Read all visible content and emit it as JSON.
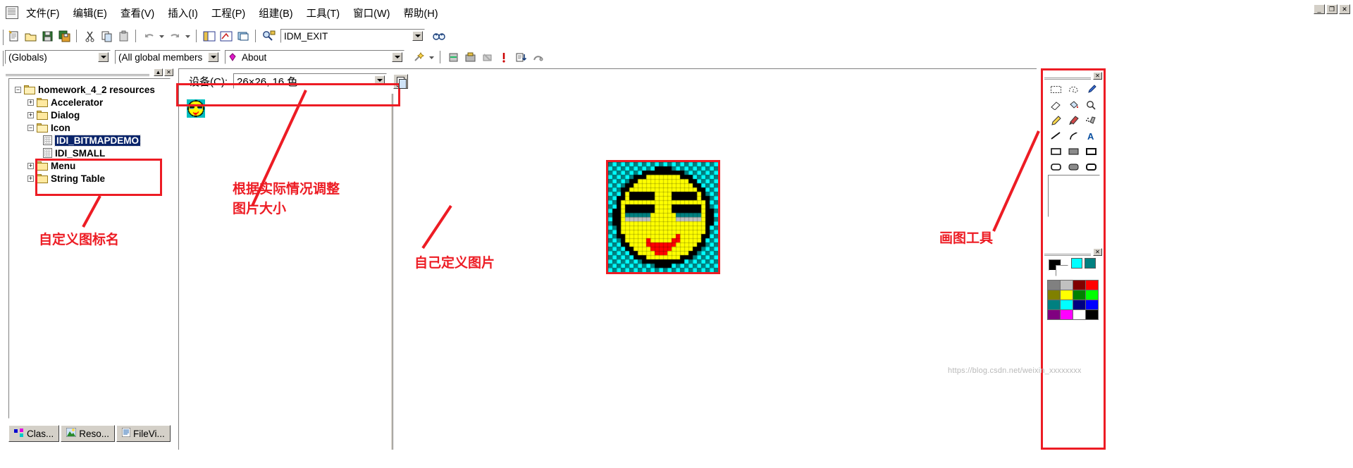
{
  "window": {
    "title_icon": "app-icon",
    "minimize": "_",
    "restore": "❐",
    "close": "✕"
  },
  "menubar": {
    "items": [
      {
        "label": "文件(F)",
        "key": "F"
      },
      {
        "label": "编辑(E)",
        "key": "E"
      },
      {
        "label": "查看(V)",
        "key": "V"
      },
      {
        "label": "插入(I)",
        "key": "I"
      },
      {
        "label": "工程(P)",
        "key": "P"
      },
      {
        "label": "组建(B)",
        "key": "B"
      },
      {
        "label": "工具(T)",
        "key": "T"
      },
      {
        "label": "窗口(W)",
        "key": "W"
      },
      {
        "label": "帮助(H)",
        "key": "H"
      }
    ]
  },
  "toolbar_main": {
    "icons": [
      "new-file-icon",
      "open-folder-icon",
      "save-icon",
      "save-all-icon",
      "cut-icon",
      "copy-icon",
      "paste-icon",
      "undo-icon",
      "redo-icon",
      "workspace-icon",
      "output-icon",
      "window-list-icon",
      "find-in-files-icon"
    ],
    "search_value": "IDM_EXIT",
    "search_placeholder": "",
    "binoculars_icon": "find-icon"
  },
  "toolbar_wizard": {
    "globals_combo": "(Globals)",
    "members_combo": "(All global members",
    "symbol_combo": "About",
    "symbol_icon": "class-member-icon",
    "wizard_icon": "wizard-bar-icon",
    "icons": [
      "compile-icon",
      "build-icon",
      "stop-build-icon",
      "execute-icon",
      "go-icon",
      "breakpoint-icon"
    ]
  },
  "workspace": {
    "title_buttons": [
      "minimize",
      "close"
    ],
    "tree": [
      {
        "label": "homework_4_2 resources",
        "type": "folder-open",
        "expander": "-",
        "depth": 0
      },
      {
        "label": "Accelerator",
        "type": "folder",
        "expander": "+",
        "depth": 1
      },
      {
        "label": "Dialog",
        "type": "folder",
        "expander": "+",
        "depth": 1
      },
      {
        "label": "Icon",
        "type": "folder-open",
        "expander": "-",
        "depth": 1
      },
      {
        "label": "IDI_BITMAPDEMO",
        "type": "resource",
        "expander": "",
        "depth": 2,
        "selected": true
      },
      {
        "label": "IDI_SMALL",
        "type": "resource",
        "expander": "",
        "depth": 2
      },
      {
        "label": "Menu",
        "type": "folder",
        "expander": "+",
        "depth": 1
      },
      {
        "label": "String Table",
        "type": "folder",
        "expander": "+",
        "depth": 1
      }
    ],
    "tabs": [
      {
        "label": "Clas...",
        "icon": "class-view-icon",
        "active": false
      },
      {
        "label": "Reso...",
        "icon": "resource-view-icon",
        "active": true
      },
      {
        "label": "FileVi...",
        "icon": "file-view-icon",
        "active": false
      }
    ]
  },
  "editor": {
    "device_label": "设备(C):",
    "device_value": "26×26, 16 色",
    "copy_button_icon": "new-device-image-icon",
    "small_preview_name": "icon-actual-size-preview",
    "large_preview_name": "icon-zoomed-editor"
  },
  "tools": {
    "panel_name": "graphics-toolbar",
    "items": [
      "rect-select-icon",
      "lasso-select-icon",
      "color-pick-icon",
      "eraser-icon",
      "fill-bucket-icon",
      "magnifier-icon",
      "pencil-icon",
      "brush-icon",
      "airbrush-icon",
      "line-icon",
      "curve-icon",
      "text-icon",
      "rectangle-icon",
      "filled-rectangle-icon",
      "outlined-rectangle-icon",
      "rounded-rect-icon",
      "filled-rounded-rect-icon",
      "outline-rounded-rect-icon",
      "ellipse-icon",
      "filled-ellipse-icon",
      "outline-ellipse-icon"
    ],
    "option_preview_name": "tool-options-preview"
  },
  "palette": {
    "panel_name": "colors-palette",
    "foreground": "#000000",
    "background": "#ffffff",
    "screen_color": "#00ffff",
    "inverse_color": "#008080",
    "colors": [
      "#808080",
      "#c0c0c0",
      "#800000",
      "#ff0000",
      "#808000",
      "#ffff00",
      "#008000",
      "#00ff00",
      "#008080",
      "#00ffff",
      "#000080",
      "#0000ff",
      "#800080",
      "#ff00ff",
      "#ffffff",
      "#000000"
    ]
  },
  "annotations": [
    {
      "id": "custom-icon-name",
      "text": "自定义图标名",
      "color": "#ed1c24"
    },
    {
      "id": "adjust-image-size",
      "text": "根据实际情况调整\n图片大小",
      "color": "#ed1c24"
    },
    {
      "id": "custom-image",
      "text": "自己定义图片",
      "color": "#ed1c24"
    },
    {
      "id": "paint-tools",
      "text": "画图工具",
      "color": "#ed1c24"
    }
  ],
  "watermark": {
    "text": "https://blog.csdn.net/weixin_xxxxxxxx"
  }
}
